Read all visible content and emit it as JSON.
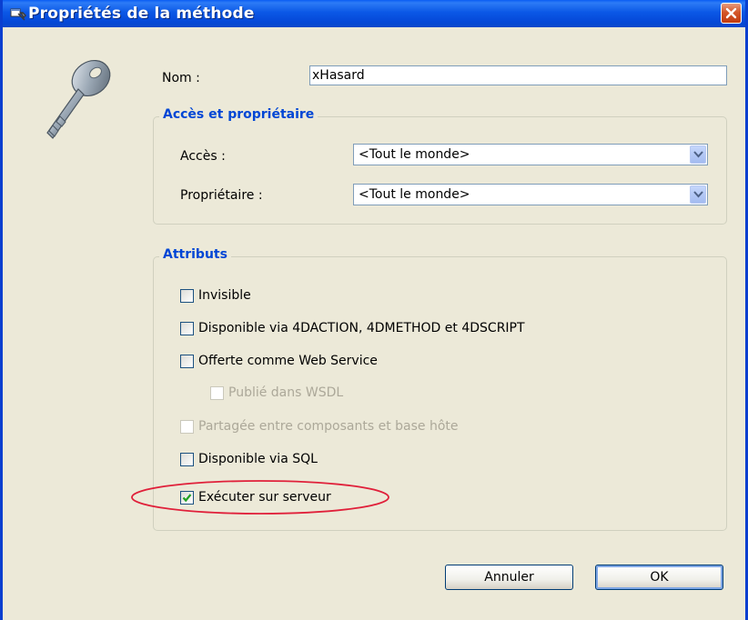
{
  "window": {
    "title": "Propriétés de la méthode",
    "titlebar_color": "#0a5df3"
  },
  "fields": {
    "nom_label": "Nom :",
    "nom_value": "xHasard"
  },
  "access_group": {
    "title": "Accès et propriétaire",
    "acces_label": "Accès :",
    "acces_value": "<Tout le monde>",
    "proprietaire_label": "Propriétaire :",
    "proprietaire_value": "<Tout le monde>"
  },
  "attributes_group": {
    "title": "Attributs",
    "items": [
      {
        "label": "Invisible",
        "checked": false,
        "enabled": true
      },
      {
        "label": "Disponible via 4DACTION, 4DMETHOD et 4DSCRIPT",
        "checked": false,
        "enabled": true
      },
      {
        "label": "Offerte comme Web Service",
        "checked": false,
        "enabled": true
      },
      {
        "label": "Publié dans WSDL",
        "checked": false,
        "enabled": false
      },
      {
        "label": "Partagée entre composants et base hôte",
        "checked": false,
        "enabled": false
      },
      {
        "label": "Disponible via SQL",
        "checked": false,
        "enabled": true
      },
      {
        "label": "Exécuter sur serveur",
        "checked": true,
        "enabled": true
      }
    ]
  },
  "buttons": {
    "cancel_label": "Annuler",
    "ok_label": "OK"
  },
  "colors": {
    "group_title": "#0046d5",
    "highlight_ellipse": "#e0203a",
    "checkmark": "#21a121"
  }
}
